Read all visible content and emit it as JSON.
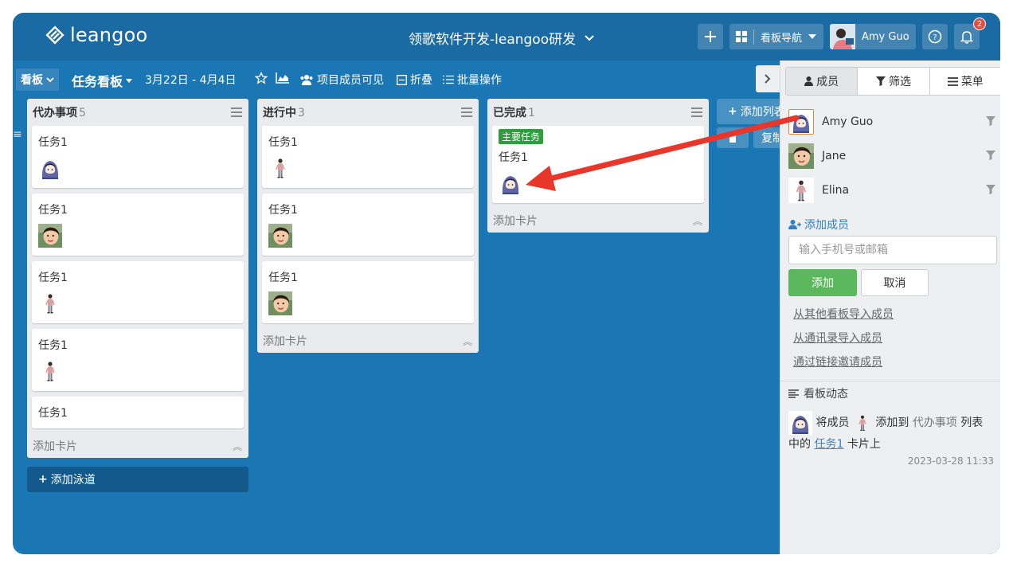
{
  "app": {
    "logo_text": "leangoo"
  },
  "header": {
    "board_title": "领歌软件开发-leangoo研发",
    "nav_label": "看板导航",
    "user_name": "Amy Guo",
    "notification_count": "2"
  },
  "toolbar": {
    "board_label": "看板",
    "board_name": "任务看板",
    "date_range": "3月22日 - 4月4日",
    "visibility_label": "项目成员可见",
    "fold_label": "折叠",
    "batch_label": "批量操作"
  },
  "lists": [
    {
      "title": "代办事项",
      "count": "5",
      "add_card": "添加卡片",
      "cards": [
        {
          "title": "任务1",
          "avatar": "hoodie"
        },
        {
          "title": "任务1",
          "avatar": "photo"
        },
        {
          "title": "任务1",
          "avatar": "figure"
        },
        {
          "title": "任务1",
          "avatar": "figure"
        },
        {
          "title": "任务1"
        }
      ]
    },
    {
      "title": "进行中",
      "count": "3",
      "add_card": "添加卡片",
      "cards": [
        {
          "title": "任务1",
          "avatar": "figure"
        },
        {
          "title": "任务1",
          "avatar": "photo"
        },
        {
          "title": "任务1",
          "avatar": "photo"
        }
      ]
    },
    {
      "title": "已完成",
      "count": "1",
      "add_card": "添加卡片",
      "cards": [
        {
          "title": "任务1",
          "tag": "主要任务",
          "avatar": "hoodie"
        }
      ]
    }
  ],
  "swimlane": {
    "add_label": "添加泳道"
  },
  "add_list": {
    "label": "添加列表",
    "copy_label": "复制"
  },
  "panel": {
    "tabs": [
      "成员",
      "筛选",
      "菜单"
    ],
    "members": [
      {
        "name": "Amy Guo",
        "avatar": "hoodie"
      },
      {
        "name": "Jane",
        "avatar": "photo"
      },
      {
        "name": "Elina",
        "avatar": "figure"
      }
    ],
    "add_member_label": "添加成员",
    "invite_placeholder": "输入手机号或邮箱",
    "add_button": "添加",
    "cancel_button": "取消",
    "import_links": [
      "从其他看板导入成员",
      "从通讯录导入成员",
      "通过链接邀请成员"
    ],
    "activity_title": "看板动态",
    "activity": {
      "text_1": "将成员",
      "text_2": "添加到",
      "list_name": "代办事项",
      "text_3": "列表",
      "text_4": "中的",
      "card_name": "任务1",
      "text_5": "卡片上",
      "time": "2023-03-28 11:33"
    }
  },
  "colors": {
    "board_bg": "#1b76b4",
    "topbar_bg": "#1a6aa3",
    "accent_green": "#5cb85c",
    "tag_green": "#2e9e3a",
    "arrow_red": "#e8362a",
    "link_blue": "#2f7fc1"
  }
}
